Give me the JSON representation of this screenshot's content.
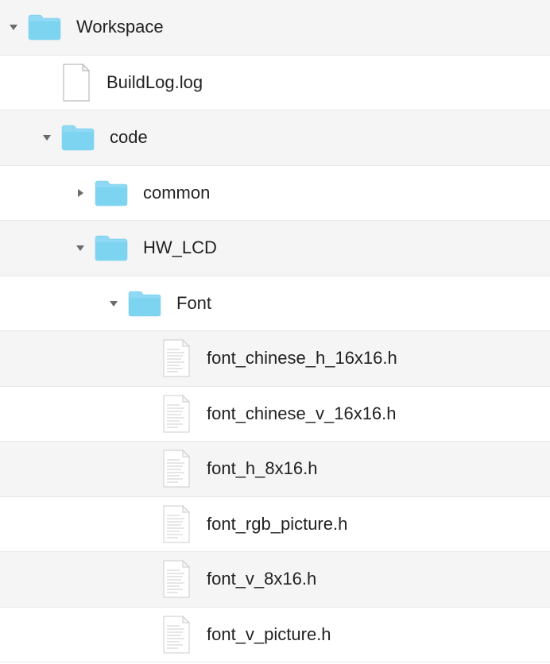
{
  "tree": {
    "items": [
      {
        "label": "Workspace",
        "icon": "folder",
        "indent": 0,
        "disclosure": "down",
        "bg": "odd"
      },
      {
        "label": "BuildLog.log",
        "icon": "file-blank",
        "indent": 1,
        "disclosure": "none",
        "bg": "even"
      },
      {
        "label": "code",
        "icon": "folder",
        "indent": 1,
        "disclosure": "down",
        "bg": "odd"
      },
      {
        "label": "common",
        "icon": "folder",
        "indent": 2,
        "disclosure": "right",
        "bg": "even"
      },
      {
        "label": "HW_LCD",
        "icon": "folder",
        "indent": 2,
        "disclosure": "down",
        "bg": "odd"
      },
      {
        "label": "Font",
        "icon": "folder",
        "indent": 3,
        "disclosure": "down",
        "bg": "even"
      },
      {
        "label": "font_chinese_h_16x16.h",
        "icon": "file-header",
        "indent": 4,
        "disclosure": "none",
        "bg": "odd"
      },
      {
        "label": "font_chinese_v_16x16.h",
        "icon": "file-header",
        "indent": 4,
        "disclosure": "none",
        "bg": "even"
      },
      {
        "label": "font_h_8x16.h",
        "icon": "file-header",
        "indent": 4,
        "disclosure": "none",
        "bg": "odd"
      },
      {
        "label": "font_rgb_picture.h",
        "icon": "file-header",
        "indent": 4,
        "disclosure": "none",
        "bg": "even"
      },
      {
        "label": "font_v_8x16.h",
        "icon": "file-header",
        "indent": 4,
        "disclosure": "none",
        "bg": "odd"
      },
      {
        "label": "font_v_picture.h",
        "icon": "file-header",
        "indent": 4,
        "disclosure": "none",
        "bg": "even"
      }
    ]
  }
}
